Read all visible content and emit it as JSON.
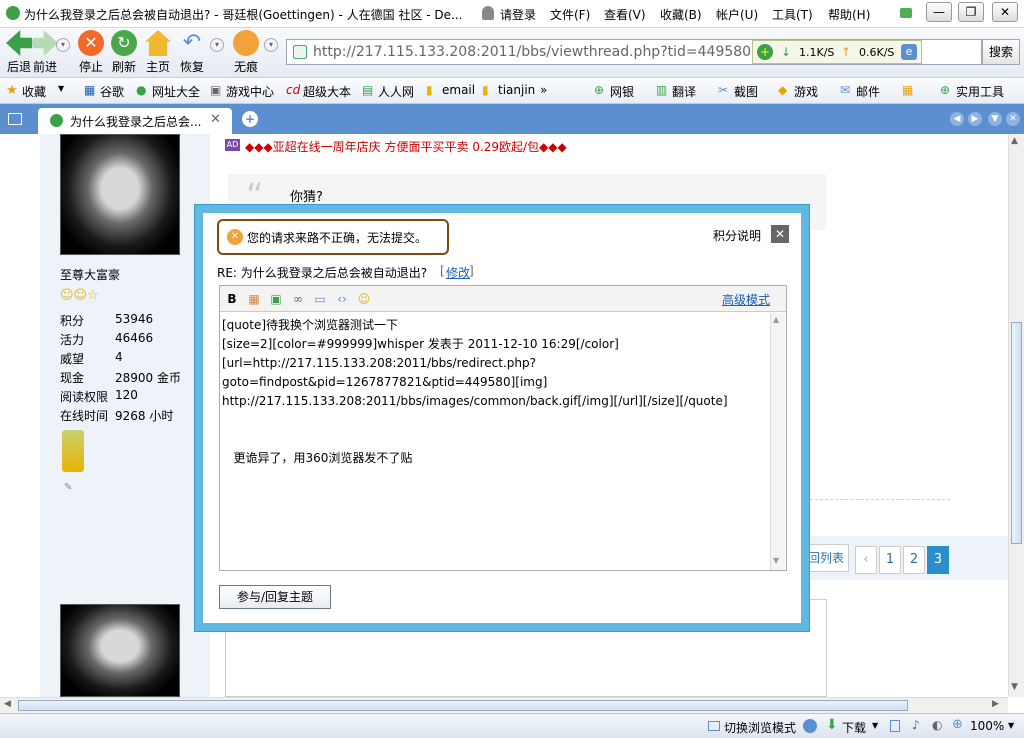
{
  "window": {
    "title": "为什么我登录之后总会被自动退出? - 哥廷根(Goettingen) - 人在德国 社区 - De..."
  },
  "titlemenu": {
    "login": "请登录",
    "file": "文件(F)",
    "view": "查看(V)",
    "favorites": "收藏(B)",
    "account": "帐户(U)",
    "tools": "工具(T)",
    "help": "帮助(H)"
  },
  "nav": {
    "back": "后退",
    "forward": "前进",
    "stop": "停止",
    "refresh": "刷新",
    "home": "主页",
    "restore": "恢复",
    "incognito": "无痕"
  },
  "address": {
    "url": "http://217.115.133.208:2011/bbs/viewthread.php?tid=449580&extra=",
    "search": "搜索"
  },
  "speed": {
    "down": "1.1K/S",
    "up": "0.6K/S"
  },
  "favbar": {
    "items": [
      "收藏",
      "谷歌",
      "网址大全",
      "游戏中心",
      "超级大本",
      "人人网",
      "email",
      "tianjin"
    ],
    "right": [
      "网银",
      "翻译",
      "截图",
      "游戏",
      "邮件",
      "实用工具"
    ]
  },
  "tab": {
    "label": "为什么我登录之后总会..."
  },
  "post": {
    "ad": "◆◆◆亚超在线一周年店庆 方便面平买平卖 0.29欧起/包◆◆◆",
    "quote": "你猜?",
    "user": "至尊大富豪",
    "stats": [
      {
        "label": "积分",
        "value": "53946"
      },
      {
        "label": "活力",
        "value": "46466"
      },
      {
        "label": "威望",
        "value": "4"
      },
      {
        "label": "现金",
        "value": "28900 金币"
      },
      {
        "label": "阅读权限",
        "value": "120"
      },
      {
        "label": "在线时间",
        "value": "9268 小时"
      }
    ],
    "back_list": "回列表",
    "pages": [
      "1",
      "2",
      "3"
    ],
    "current_page": "3"
  },
  "dialog": {
    "error": "您的请求来路不正确，无法提交。",
    "credits": "积分说明",
    "subject_prefix": "RE: 为什么我登录之后总会被自动退出?",
    "edit_link": "修改",
    "advanced": "高级模式",
    "content": "[quote]待我换个浏览器测试一下\n[size=2][color=#999999]whisper 发表于 2011-12-10 16:29[/color]\n[url=http://217.115.133.208:2011/bbs/redirect.php?\ngoto=findpost&pid=1267877821&ptid=449580][img]\nhttp://217.115.133.208:2011/bbs/images/common/back.gif[/img][/url][/size][/quote]\n\n\n   更诡异了，用360浏览器发不了贴",
    "submit": "参与/回复主题"
  },
  "status": {
    "mode": "切换浏览模式",
    "download": "下载",
    "zoom": "100%"
  }
}
